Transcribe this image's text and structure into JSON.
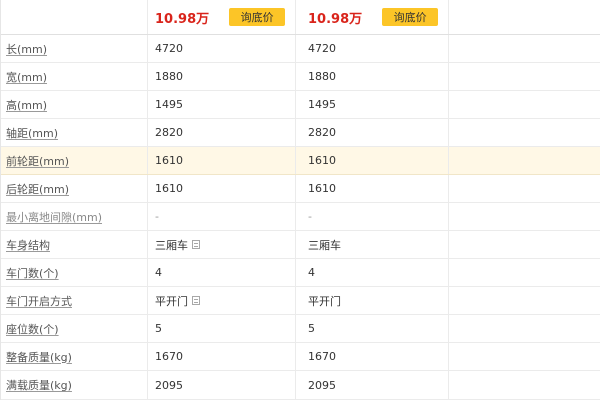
{
  "price_row": {
    "col1_price": "10.98万",
    "col1_button": "询底价",
    "col2_price": "10.98万",
    "col2_button": "询底价"
  },
  "specs": [
    {
      "label": "长(mm)",
      "v1": "4720",
      "v2": "4720"
    },
    {
      "label": "宽(mm)",
      "v1": "1880",
      "v2": "1880"
    },
    {
      "label": "高(mm)",
      "v1": "1495",
      "v2": "1495"
    },
    {
      "label": "轴距(mm)",
      "v1": "2820",
      "v2": "2820"
    },
    {
      "label": "前轮距(mm)",
      "v1": "1610",
      "v2": "1610"
    },
    {
      "label": "后轮距(mm)",
      "v1": "1610",
      "v2": "1610"
    },
    {
      "label": "最小离地间隙(mm)",
      "v1": "-",
      "v2": "-"
    },
    {
      "label": "车身结构",
      "v1": "三厢车",
      "v2": "三厢车"
    },
    {
      "label": "车门数(个)",
      "v1": "4",
      "v2": "4"
    },
    {
      "label": "车门开启方式",
      "v1": "平开门",
      "v2": "平开门"
    },
    {
      "label": "座位数(个)",
      "v1": "5",
      "v2": "5"
    },
    {
      "label": "整备质量(kg)",
      "v1": "1670",
      "v2": "1670"
    },
    {
      "label": "满载质量(kg)",
      "v1": "2095",
      "v2": "2095"
    }
  ],
  "highlighted_row_label": "前轮距(mm)",
  "colors": {
    "price": "#d9241b",
    "button_bg": "#fcc527",
    "highlight_bg": "#fff8e6",
    "border": "#ebebeb"
  },
  "icons": [
    "info-icon"
  ]
}
